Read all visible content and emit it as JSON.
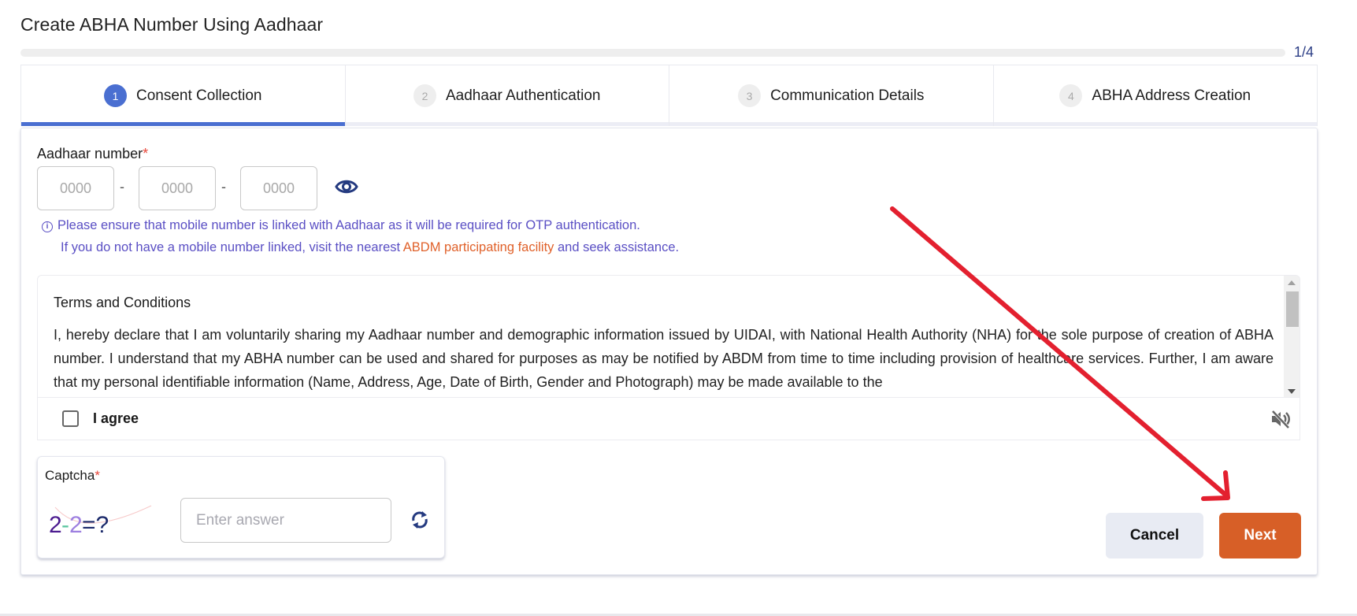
{
  "page": {
    "title": "Create ABHA Number Using Aadhaar",
    "progress": {
      "current": 1,
      "total": 4,
      "label": "1/4"
    }
  },
  "stepper": {
    "steps": [
      {
        "number": "1",
        "label": "Consent Collection",
        "active": true
      },
      {
        "number": "2",
        "label": "Aadhaar Authentication",
        "active": false
      },
      {
        "number": "3",
        "label": "Communication Details",
        "active": false
      },
      {
        "number": "4",
        "label": "ABHA Address Creation",
        "active": false
      }
    ]
  },
  "aadhaar": {
    "label": "Aadhaar number",
    "required_mark": "*",
    "separator": "-",
    "fields": [
      {
        "value": "",
        "placeholder": "0000"
      },
      {
        "value": "",
        "placeholder": "0000"
      },
      {
        "value": "",
        "placeholder": "0000"
      }
    ],
    "toggle_icon": "eye-icon",
    "info": {
      "icon": "info-icon",
      "line1": "Please ensure that mobile number is linked with Aadhaar as it will be required for OTP authentication.",
      "line2_prefix": "If you do not have a mobile number linked, visit the nearest ",
      "line2_link": "ABDM participating facility",
      "line2_suffix": " and seek assistance."
    }
  },
  "terms": {
    "title": "Terms and Conditions",
    "text": "I, hereby declare that I am voluntarily sharing my Aadhaar number and demographic information issued by UIDAI, with National Health Authority (NHA) for the sole purpose of creation of ABHA number. I understand that my ABHA number can be used and shared for purposes as may be notified by ABDM from time to time including provision of healthcare services. Further, I am aware that my personal identifiable information (Name, Address, Age, Date of Birth, Gender and Photograph) may be made available to the",
    "agree_label": "I agree",
    "agree_checked": false,
    "audio_icon": "mute-icon"
  },
  "captcha": {
    "label": "Captcha",
    "required_mark": "*",
    "challenge": {
      "a": "2",
      "op": "-",
      "b": "2",
      "eq": "=?"
    },
    "input_value": "",
    "input_placeholder": "Enter answer",
    "refresh_icon": "refresh-icon"
  },
  "actions": {
    "cancel_label": "Cancel",
    "next_label": "Next"
  },
  "colors": {
    "accent_blue": "#4a6fd1",
    "info_purple": "#5a4fc4",
    "link_orange": "#e0612a",
    "next_button": "#d75f27",
    "annotation_red": "#e3202f"
  }
}
